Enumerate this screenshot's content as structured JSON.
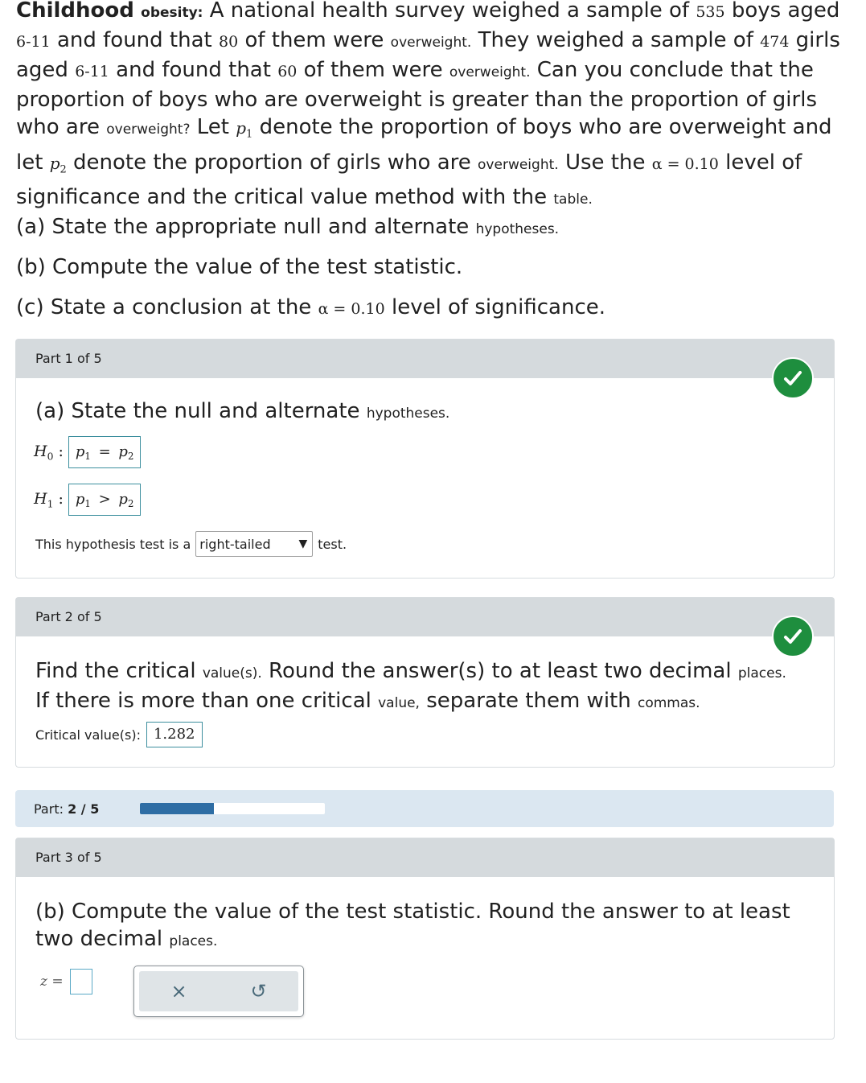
{
  "problem": {
    "title_bold": "Childhood",
    "title_small": "obesity:",
    "s1": "A national health survey weighed a sample of",
    "n_boys": "535",
    "s2": "boys aged",
    "age1": "6-11",
    "s3": "and found that",
    "x_boys": "80",
    "s4": "of them were",
    "ow1": "overweight.",
    "s5": "They weighed a sample of",
    "n_girls": "474",
    "s6": "girls aged",
    "age2": "6-11",
    "s7": "and found that",
    "x_girls": "60",
    "s8": "of them were",
    "ow2": "overweight.",
    "s9": "Can you conclude that the proportion of boys who are overweight is greater than the proportion of girls who are",
    "ow3": "overweight?",
    "s10": "Let",
    "p1": "p",
    "p1_sub": "1",
    "s11": "denote the proportion of boys who are overweight and let",
    "p2": "p",
    "p2_sub": "2",
    "s12": "denote the proportion of girls who are",
    "ow4": "overweight.",
    "s13": "Use the",
    "alpha": "α = 0.10",
    "s14": "level of significance and the critical value method with the",
    "table": "table."
  },
  "items": {
    "a": "(a) State the appropriate null and alternate",
    "a_small": "hypotheses.",
    "b": "(b) Compute the value of the test statistic.",
    "c_pre": "(c) State a conclusion at the",
    "c_alpha": "α = 0.10",
    "c_post": "level of significance."
  },
  "part1": {
    "header": "Part 1 of 5",
    "heading": "(a) State the null and alternate",
    "heading_small": "hypotheses.",
    "h0_label": "H",
    "h0_sub": "0",
    "h0_lhs": "p",
    "h0_lhs_sub": "1",
    "h0_op": "=",
    "h0_rhs": "p",
    "h0_rhs_sub": "2",
    "h1_label": "H",
    "h1_sub": "1",
    "h1_lhs": "p",
    "h1_lhs_sub": "1",
    "h1_op": ">",
    "h1_rhs": "p",
    "h1_rhs_sub": "2",
    "colon": ":",
    "test_pre": "This hypothesis test is a",
    "test_value": "right-tailed",
    "test_post": "test."
  },
  "part2": {
    "header": "Part 2 of 5",
    "line1": "Find the critical",
    "line1_small": "value(s).",
    "line1b": "Round the answer(s) to at least two decimal",
    "line1_small2": "places.",
    "line2": "If there is more than one critical",
    "line2_small": "value,",
    "line2b": "separate them with",
    "line2_small2": "commas.",
    "label": "Critical value(s):",
    "value": "1.282"
  },
  "progress": {
    "label": "Part:",
    "value": "2 / 5",
    "fraction": 0.4
  },
  "part3": {
    "header": "Part 3 of 5",
    "line1": "(b) Compute the value of the test statistic. Round the answer to at least",
    "line2": "two decimal",
    "line2_small": "places.",
    "z_label": "z =",
    "z_value": ""
  },
  "icons": {
    "check": "check-icon",
    "clear": "×",
    "undo": "↺"
  },
  "colors": {
    "check": "#1e8e3e",
    "progress_fill": "#2e6da4",
    "answer_border": "#3d8f9e"
  }
}
